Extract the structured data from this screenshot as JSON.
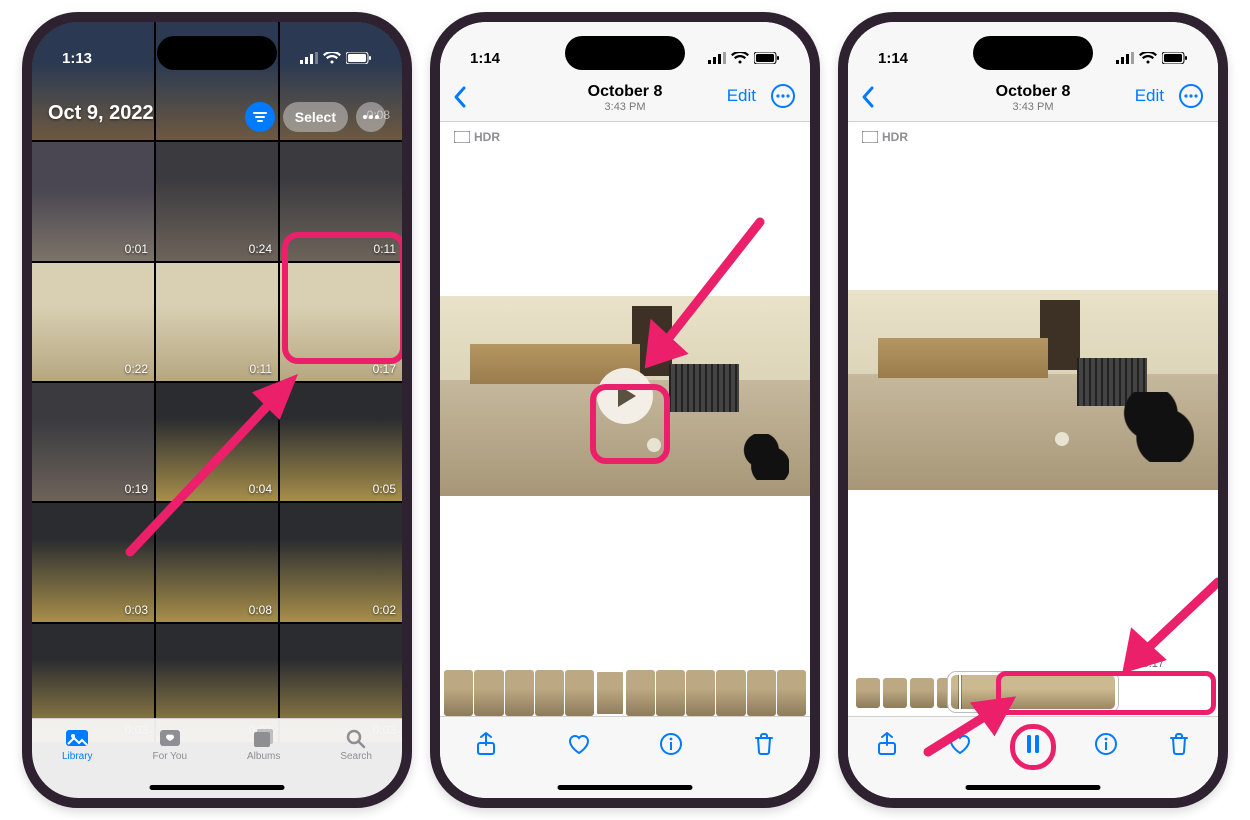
{
  "status": {
    "time_p1": "1:13",
    "time_p23": "1:14"
  },
  "library": {
    "date_header": "Oct 9, 2022",
    "select_label": "Select",
    "ghost_time": "0:08",
    "tabs": [
      {
        "label": "Library"
      },
      {
        "label": "For You"
      },
      {
        "label": "Albums"
      },
      {
        "label": "Search"
      }
    ],
    "thumbs": [
      {
        "dur": "",
        "cls": "bg-party"
      },
      {
        "dur": "",
        "cls": "bg-party"
      },
      {
        "dur": "",
        "cls": "bg-party"
      },
      {
        "dur": "0:01",
        "cls": "bg-couch"
      },
      {
        "dur": "0:24",
        "cls": "bg-living"
      },
      {
        "dur": "0:11",
        "cls": "bg-living"
      },
      {
        "dur": "0:22",
        "cls": "bg-kitchen"
      },
      {
        "dur": "0:11",
        "cls": "bg-kitchen"
      },
      {
        "dur": "0:17",
        "cls": "bg-kitchen"
      },
      {
        "dur": "0:19",
        "cls": "bg-living"
      },
      {
        "dur": "0:04",
        "cls": "bg-desk"
      },
      {
        "dur": "0:05",
        "cls": "bg-desk"
      },
      {
        "dur": "0:03",
        "cls": "bg-desk"
      },
      {
        "dur": "0:08",
        "cls": "bg-desk"
      },
      {
        "dur": "0:02",
        "cls": "bg-desk"
      },
      {
        "dur": "0:03",
        "cls": "bg-desk"
      },
      {
        "dur": "0:03",
        "cls": "bg-desk"
      },
      {
        "dur": "0:03",
        "cls": "bg-desk"
      }
    ]
  },
  "detail": {
    "title": "October 8",
    "subtitle": "3:43 PM",
    "edit": "Edit",
    "hdr": "HDR",
    "time_remaining": "-00:17"
  }
}
